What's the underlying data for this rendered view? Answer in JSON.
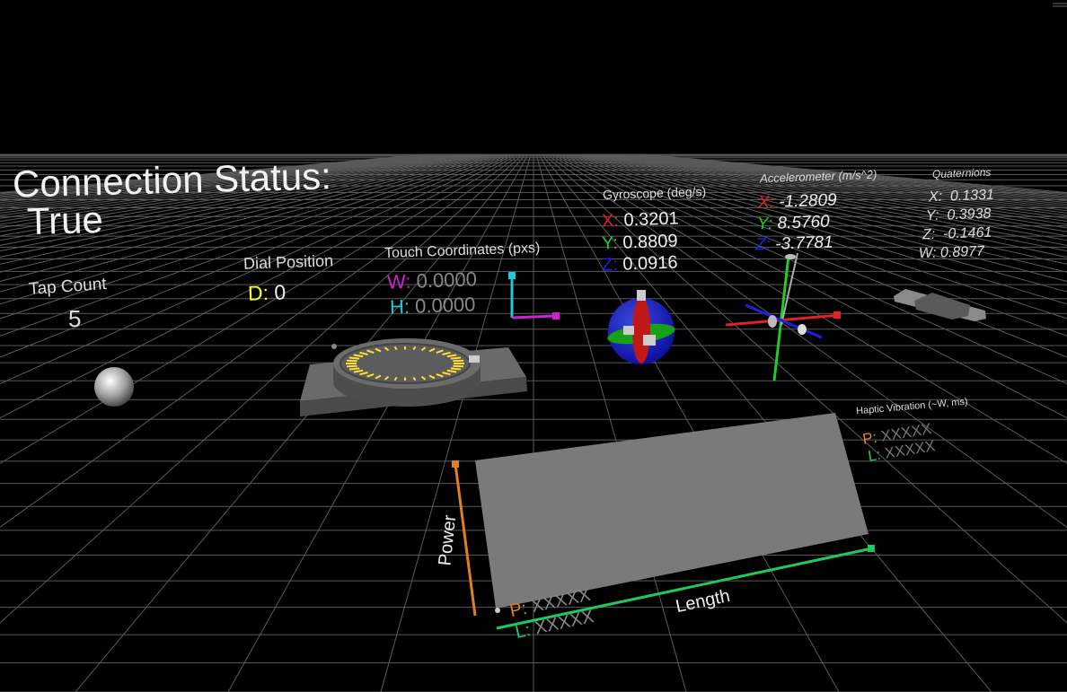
{
  "connection": {
    "title": "Connection Status:",
    "value": "True"
  },
  "tap": {
    "label": "Tap Count",
    "value": "5"
  },
  "dial": {
    "label": "Dial Position",
    "prefix": "D:",
    "value": "0"
  },
  "touch": {
    "label": "Touch Coordinates (pxs)",
    "w_prefix": "W:",
    "w_value": "0.0000",
    "h_prefix": "H:",
    "h_value": "0.0000"
  },
  "gyroscope": {
    "label": "Gyroscope (deg/s)",
    "x_prefix": "X:",
    "x": "0.3201",
    "y_prefix": "Y:",
    "y": "0.8809",
    "z_prefix": "Z:",
    "z": "0.0916"
  },
  "accelerometer": {
    "label": "Accelerometer (m/s^2)",
    "x_prefix": "X:",
    "x": "-1.2809",
    "y_prefix": "Y:",
    "y": "8.5760",
    "z_prefix": "Z:",
    "z": "-3.7781"
  },
  "quaternions": {
    "label": "Quaternions",
    "x_prefix": "X:",
    "x": "0.1331",
    "y_prefix": "Y:",
    "y": "0.3938",
    "z_prefix": "Z:",
    "z": "-0.1461",
    "w_prefix": "W:",
    "w": "0.8977"
  },
  "haptic": {
    "label": "Haptic Vibration (~W, ms)",
    "p_prefix": "P:",
    "p_value": "XXXXX",
    "l_prefix": "L:",
    "l_value": "XXXXX",
    "power_label": "Power",
    "length_label": "Length",
    "plot_p_prefix": "P:",
    "plot_p_value": "XXXXX",
    "plot_l_prefix": "L:",
    "plot_l_value": "XXXXX"
  },
  "colors": {
    "x_axis": "#e52020",
    "y_axis": "#22cc22",
    "z_axis": "#2020e5",
    "touch_w": "#d020d0",
    "touch_h": "#20c8d8",
    "dial": "#ffff20",
    "power": "#e08020",
    "length": "#20c860",
    "panel": "#7a7a7a",
    "background": "#000000"
  }
}
